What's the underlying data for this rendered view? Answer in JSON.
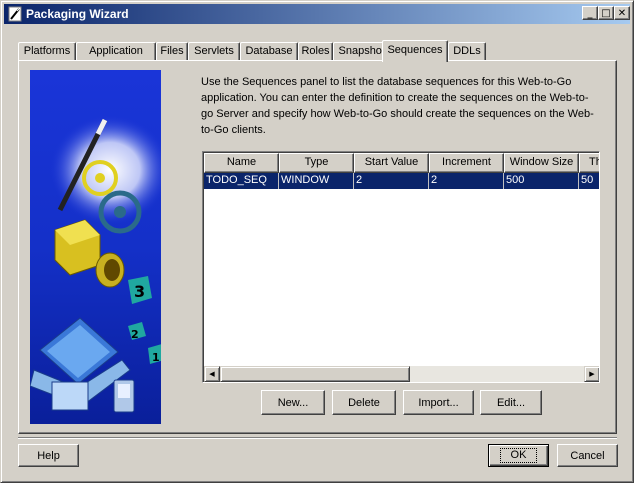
{
  "window": {
    "title": "Packaging Wizard",
    "minimize_glyph": "_",
    "maximize_glyph": "□",
    "close_glyph": "✕"
  },
  "tabs": [
    {
      "label": "Platforms",
      "active": false
    },
    {
      "label": "Application",
      "active": false
    },
    {
      "label": "Files",
      "active": false
    },
    {
      "label": "Servlets",
      "active": false
    },
    {
      "label": "Database",
      "active": false
    },
    {
      "label": "Roles",
      "active": false
    },
    {
      "label": "Snapshots",
      "active": false
    },
    {
      "label": "Sequences",
      "active": true
    },
    {
      "label": "DDLs",
      "active": false
    }
  ],
  "panel": {
    "description_lines": [
      "Use the Sequences panel to list the database sequences for this Web-to-Go",
      "application. You can enter the definition to create the sequences on the Web-to-",
      "go Server and specify how Web-to-Go should create the sequences on the Web-",
      "to-Go clients."
    ],
    "illustration_digits": [
      "3",
      "2",
      "1"
    ]
  },
  "table": {
    "columns": [
      "Name",
      "Type",
      "Start Value",
      "Increment",
      "Window Size",
      "Th"
    ],
    "rows": [
      [
        "TODO_SEQ",
        "WINDOW",
        "2",
        "2",
        "500",
        "50"
      ]
    ],
    "selected_row": 0
  },
  "scrollbar": {
    "left_glyph": "◀",
    "right_glyph": "▶"
  },
  "actions": {
    "new": "New...",
    "delete": "Delete",
    "import": "Import...",
    "edit": "Edit..."
  },
  "footer": {
    "help": "Help",
    "ok": "OK",
    "cancel": "Cancel"
  },
  "colors": {
    "titlebar_start": "#0a246a",
    "titlebar_end": "#a6caf0",
    "selection": "#0a246a",
    "face": "#d4d0c8"
  }
}
